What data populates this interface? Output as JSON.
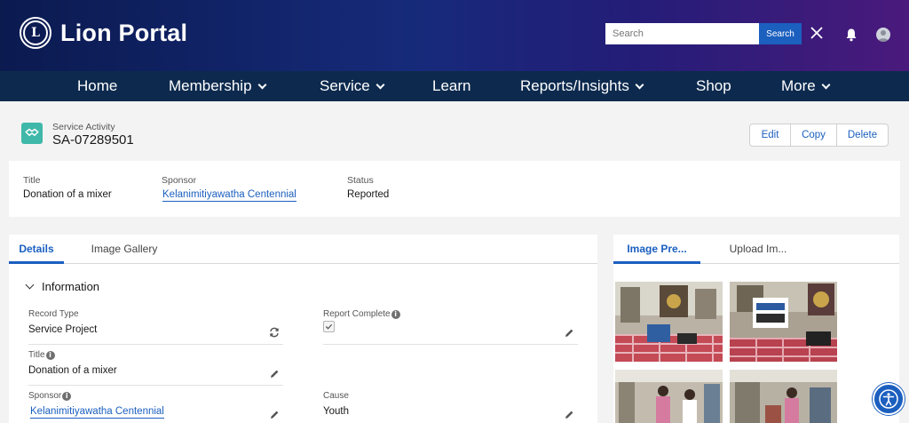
{
  "header": {
    "brand": "Lion Portal",
    "search_placeholder": "Search",
    "search_button": "Search"
  },
  "nav": {
    "items": [
      {
        "label": "Home",
        "dropdown": false
      },
      {
        "label": "Membership",
        "dropdown": true
      },
      {
        "label": "Service",
        "dropdown": true
      },
      {
        "label": "Learn",
        "dropdown": false
      },
      {
        "label": "Reports/Insights",
        "dropdown": true
      },
      {
        "label": "Shop",
        "dropdown": false
      },
      {
        "label": "More",
        "dropdown": true
      }
    ]
  },
  "record": {
    "type_label": "Service Activity",
    "id": "SA-07289501",
    "actions": {
      "edit": "Edit",
      "copy": "Copy",
      "delete": "Delete"
    }
  },
  "highlights": {
    "title_label": "Title",
    "title_value": "Donation of a mixer",
    "sponsor_label": "Sponsor",
    "sponsor_value": "Kelanimitiyawatha Centennial",
    "status_label": "Status",
    "status_value": "Reported"
  },
  "main_tabs": {
    "details": "Details",
    "gallery": "Image Gallery"
  },
  "section": {
    "title": "Information"
  },
  "fields": {
    "record_type_label": "Record Type",
    "record_type_value": "Service Project",
    "report_complete_label": "Report Complete",
    "report_complete_checked": true,
    "title_label": "Title",
    "title_value": "Donation of a mixer",
    "sponsor_label": "Sponsor",
    "sponsor_value": "Kelanimitiyawatha Centennial",
    "cause_label": "Cause",
    "cause_value": "Youth"
  },
  "side_tabs": {
    "preview": "Image Pre...",
    "upload": "Upload Im..."
  },
  "colors": {
    "accent": "#1b5fbf",
    "nav_bg": "#0d2a4e",
    "record_icon": "#3fb8a9"
  },
  "icons": {
    "logo": "lions-logo-icon",
    "clear": "close-icon",
    "notifications": "bell-icon",
    "user": "user-avatar-icon",
    "record": "handshake-icon",
    "edit": "pencil-icon",
    "record_type_change": "change-record-type-icon",
    "accessibility": "accessibility-icon"
  }
}
